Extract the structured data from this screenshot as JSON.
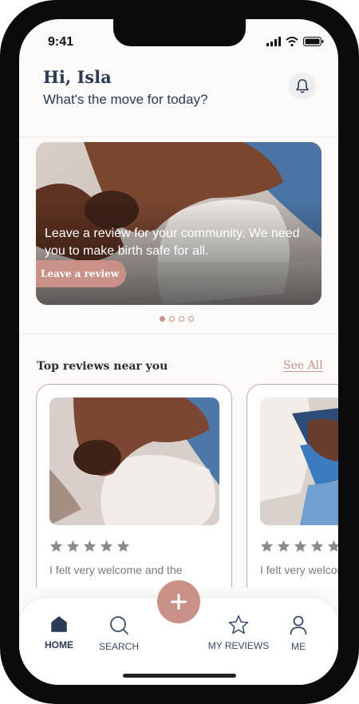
{
  "status_bar": {
    "time": "9:41"
  },
  "header": {
    "greeting": "Hi, Isla",
    "subtitle": "What's the move for today?",
    "bell_icon": "bell-icon"
  },
  "banner": {
    "text": "Leave a review for your community. We need you to make birth safe for all.",
    "button_label": "Leave a review",
    "pagination": {
      "count": 4,
      "active_index": 0
    }
  },
  "reviews_section": {
    "title": "Top reviews near you",
    "see_all_label": "See All",
    "cards": [
      {
        "rating": 5,
        "excerpt": "I felt very welcome and the"
      },
      {
        "rating": 5,
        "excerpt": "I felt very welcome and the"
      }
    ]
  },
  "bottom_nav": {
    "items": [
      {
        "label": "HOME",
        "icon": "home-icon",
        "active": true
      },
      {
        "label": "SEARCH",
        "icon": "search-icon",
        "active": false
      },
      {
        "label": "MY REVIEWS",
        "icon": "star-icon",
        "active": false
      },
      {
        "label": "ME",
        "icon": "person-icon",
        "active": false
      }
    ],
    "fab_icon": "plus-icon"
  },
  "colors": {
    "accent": "#c99187",
    "heading": "#2b3a55",
    "star": "#8a8a8a"
  }
}
